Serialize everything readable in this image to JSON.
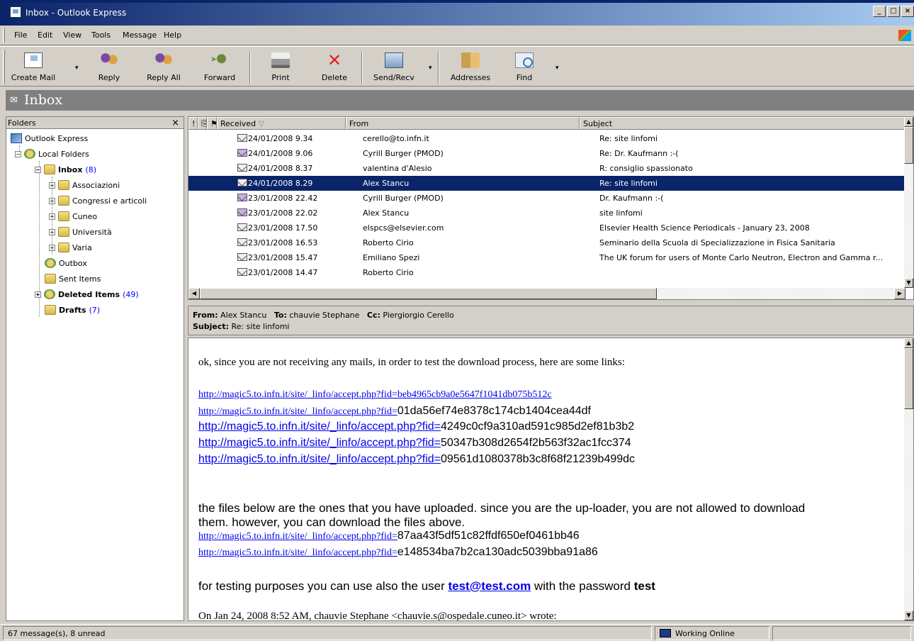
{
  "window": {
    "title": "Inbox - Outlook Express"
  },
  "menu": [
    "File",
    "Edit",
    "View",
    "Tools",
    "Message",
    "Help"
  ],
  "toolbar": {
    "create_mail": "Create Mail",
    "reply": "Reply",
    "reply_all": "Reply All",
    "forward": "Forward",
    "print": "Print",
    "delete": "Delete",
    "send_recv": "Send/Recv",
    "addresses": "Addresses",
    "find": "Find"
  },
  "banner": {
    "title": "Inbox"
  },
  "folders": {
    "header": "Folders",
    "close": "×",
    "items": [
      {
        "label": "Outlook Express",
        "count": ""
      },
      {
        "label": "Local Folders",
        "count": ""
      },
      {
        "label": "Inbox",
        "count": "(8)"
      },
      {
        "label": "Associazioni",
        "count": ""
      },
      {
        "label": "Congressi e articoli",
        "count": ""
      },
      {
        "label": "Cuneo",
        "count": ""
      },
      {
        "label": "Università",
        "count": ""
      },
      {
        "label": "Varia",
        "count": ""
      },
      {
        "label": "Outbox",
        "count": ""
      },
      {
        "label": "Sent Items",
        "count": ""
      },
      {
        "label": "Deleted Items",
        "count": "(49)"
      },
      {
        "label": "Drafts",
        "count": "(7)"
      }
    ]
  },
  "list": {
    "columns": {
      "received": "Received",
      "from": "From",
      "subject": "Subject"
    },
    "rows": [
      {
        "received": "24/01/2008 9.34",
        "from": "cerello@to.infn.it",
        "subject": "Re: site linfomi"
      },
      {
        "received": "24/01/2008 9.06",
        "from": "Cyrill Burger (PMOD)",
        "subject": "Re: Dr. Kaufmann :-("
      },
      {
        "received": "24/01/2008 8.37",
        "from": "valentina d'Alesio",
        "subject": "R: consiglio spassionato"
      },
      {
        "received": "24/01/2008 8.29",
        "from": "Alex Stancu",
        "subject": "Re: site linfomi"
      },
      {
        "received": "23/01/2008 22.42",
        "from": "Cyrill Burger (PMOD)",
        "subject": "Dr. Kaufmann :-("
      },
      {
        "received": "23/01/2008 22.02",
        "from": "Alex Stancu",
        "subject": "site linfomi"
      },
      {
        "received": "23/01/2008 17.50",
        "from": "elspcs@elsevier.com",
        "subject": "Elsevier Health Science Periodicals - January 23, 2008"
      },
      {
        "received": "23/01/2008 16.53",
        "from": "Roberto Cirio",
        "subject": "Seminario della Scuola di Specializzazione in Fisica Sanitaria"
      },
      {
        "received": "23/01/2008 15.47",
        "from": "Emiliano Spezi",
        "subject": "The UK forum for users of Monte Carlo Neutron, Electron and Gamma r..."
      },
      {
        "received": "23/01/2008 14.47",
        "from": "Roberto Cirio",
        "subject": ""
      }
    ]
  },
  "preview": {
    "from_label": "From:",
    "from": "Alex Stancu",
    "to_label": "To:",
    "to": "chauvie Stephane",
    "cc_label": "Cc:",
    "cc": "Piergiorgio Cerello",
    "subject_label": "Subject:",
    "subject": "Re: site linfomi"
  },
  "message": {
    "intro": "ok, since you are not receiving any mails, in order to test the download process, here are some links:",
    "links": [
      {
        "link": "http://magic5.to.infn.it/site/_linfo/accept.php?fid=beb4965cb9a0e5647f1041db075b512c",
        "rest": ""
      },
      {
        "link": "http://magic5.to.infn.it/site/_linfo/accept.php?fid=",
        "rest": "01da56ef74e8378c174cb1404cea44df"
      },
      {
        "link": "http://magic5.to.infn.it/site/_linfo/accept.php?fid=",
        "rest": "4249c0cf9a310ad591c985d2ef81b3b2"
      },
      {
        "link": "http://magic5.to.infn.it/site/_linfo/accept.php?fid=",
        "rest": "50347b308d2654f2b563f32ac1fcc374"
      },
      {
        "link": "http://magic5.to.infn.it/site/_linfo/accept.php?fid=",
        "rest": "09561d1080378b3c8f68f21239b499dc"
      }
    ],
    "files_line1": "the files below are the ones that you have uploaded. since you are the up-loader, you are not allowed to download",
    "files_line2": "them. however, you can download the files above.",
    "links2": [
      {
        "link": "http://magic5.to.infn.it/site/_linfo/accept.php?fid=",
        "rest": "87aa43f5df51c82ffdf650ef0461bb46"
      },
      {
        "link": "http://magic5.to.infn.it/site/_linfo/accept.php?fid=",
        "rest": "e148534ba7b2ca130adc5039bba91a86"
      }
    ],
    "testing_pre": "for testing purposes you can use also the user ",
    "testing_user": "test@test.com",
    "testing_mid": " with the password ",
    "testing_pw": "test",
    "quote_partial": "On Jan 24, 2008 8:52 AM, chauvie Stephane <chauvie.s@ospedale.cuneo.it> wrote:"
  },
  "status": {
    "messages": "67 message(s), 8 unread",
    "online": "Working Online"
  }
}
